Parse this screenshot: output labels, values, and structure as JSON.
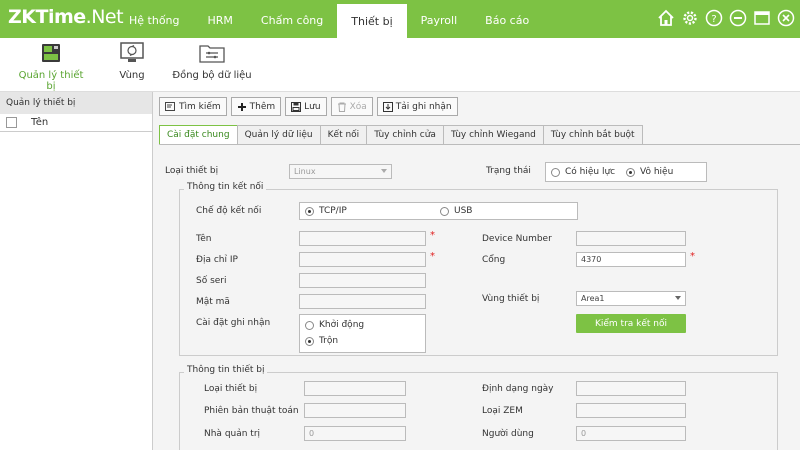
{
  "app": {
    "logo_main": "ZKTime",
    "logo_suffix": ".Net"
  },
  "nav": [
    {
      "label": "Hệ thống"
    },
    {
      "label": "HRM"
    },
    {
      "label": "Chấm công"
    },
    {
      "label": "Thiết bị"
    },
    {
      "label": "Payroll"
    },
    {
      "label": "Báo cáo"
    }
  ],
  "nav_active": "Thiết bị",
  "window_icons": [
    "home-icon",
    "gear-icon",
    "help-icon",
    "minimize-icon",
    "maximize-icon",
    "close-icon"
  ],
  "subnav": [
    {
      "label": "Quản lý thiết bị",
      "icon": "device-icon"
    },
    {
      "label": "Vùng",
      "icon": "area-icon"
    },
    {
      "label": "Đồng bộ dữ liệu",
      "icon": "sync-folder-icon"
    }
  ],
  "left_panel": {
    "title": "Quản lý thiết bị",
    "column_header": "Tên"
  },
  "actions": [
    {
      "label": "Tìm kiếm",
      "icon": "search-icon"
    },
    {
      "label": "Thêm",
      "icon": "plus-icon"
    },
    {
      "label": "Lưu",
      "icon": "save-icon"
    },
    {
      "label": "Xóa",
      "icon": "trash-icon",
      "disabled": true
    },
    {
      "label": "Tải ghi nhận",
      "icon": "download-icon"
    }
  ],
  "tabs": [
    {
      "label": "Cài đặt chung"
    },
    {
      "label": "Quản lý dữ liệu"
    },
    {
      "label": "Kết nối"
    },
    {
      "label": "Tùy chỉnh cửa"
    },
    {
      "label": "Tùy chỉnh Wiegand"
    },
    {
      "label": "Tùy chỉnh bắt buột"
    }
  ],
  "form": {
    "device_type_label": "Loại thiết bị",
    "device_type_value": "Linux",
    "status_label": "Trạng thái",
    "status_options": [
      "Có hiệu lực",
      "Vô hiệu"
    ],
    "status_selected": "Vô hiệu",
    "conn_group_title": "Thông tin kết nối",
    "conn_mode_label": "Chế độ kết nối",
    "conn_mode_options": [
      "TCP/IP",
      "USB"
    ],
    "conn_mode_selected": "TCP/IP",
    "name_label": "Tên",
    "ip_label": "Địa chỉ IP",
    "serial_label": "Số seri",
    "password_label": "Mật mã",
    "record_setting_label": "Cài đặt ghi nhận",
    "record_options": [
      "Khởi động",
      "Trộn"
    ],
    "record_selected": "Trộn",
    "device_number_label": "Device Number",
    "port_label": "Cổng",
    "port_value": "4370",
    "area_label": "Vùng thiết bị",
    "area_value": "Area1",
    "test_button": "Kiểm tra kết nối",
    "info_group_title": "Thông tin thiết bị",
    "info_device_type_label": "Loại thiết bị",
    "algorithm_label": "Phiên bản thuật toán",
    "admin_label": "Nhà quản trị",
    "admin_value": "0",
    "date_format_label": "Định dạng ngày",
    "zem_label": "Loại ZEM",
    "users_label": "Người dùng",
    "users_value": "0"
  },
  "colors": {
    "brand_green": "#7dc244",
    "required_red": "#e02020"
  }
}
